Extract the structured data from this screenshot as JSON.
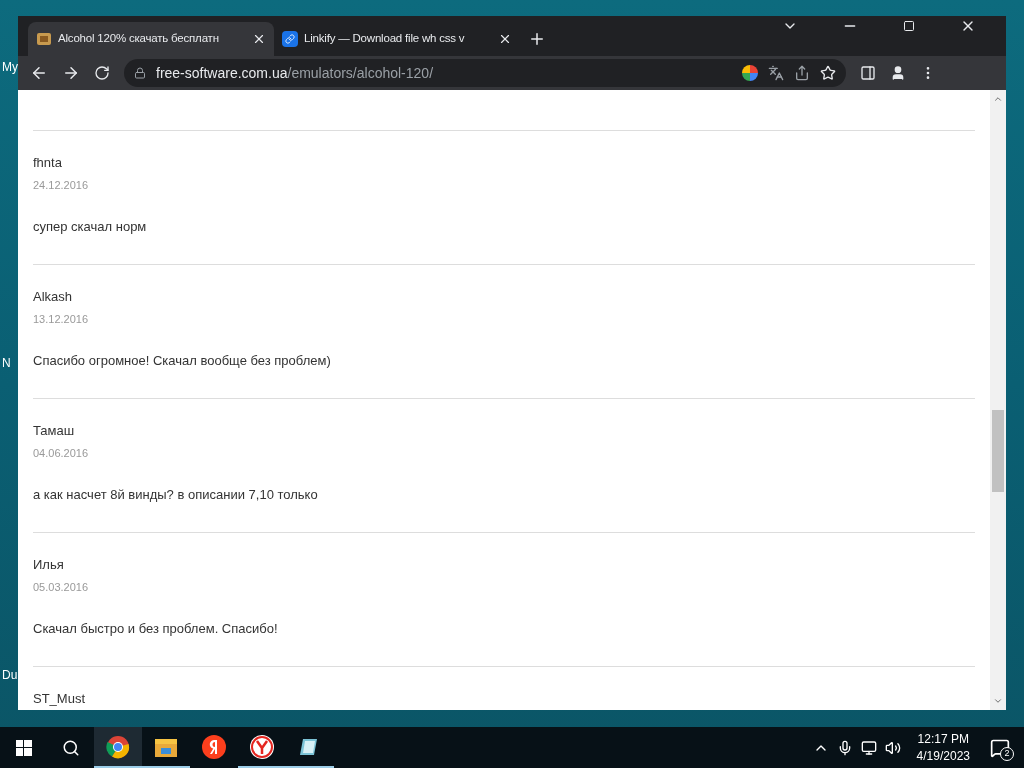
{
  "desktop": {
    "icon_labels": [
      "My",
      "N",
      "Du"
    ]
  },
  "browser": {
    "tabs": [
      {
        "title": "Alcohol 120% скачать бесплатн",
        "selected": true
      },
      {
        "title": "Linkify — Download file wh css v",
        "selected": false
      }
    ],
    "url": {
      "host": "free-software.com.ua",
      "path": "/emulators/alcohol-120/"
    }
  },
  "comments": [
    {
      "author": "fhnta",
      "date": "24.12.2016",
      "text": "супер скачал норм"
    },
    {
      "author": "Alkash",
      "date": "13.12.2016",
      "text": "Спасибо огромное! Скачал вообще без проблем)"
    },
    {
      "author": "Тамаш",
      "date": "04.06.2016",
      "text": "а как насчет 8й винды? в описании 7,10 только"
    },
    {
      "author": "Илья",
      "date": "05.03.2016",
      "text": "Скачал быстро и без проблем. Спасибо!"
    },
    {
      "author": "ST_Must"
    }
  ],
  "taskbar": {
    "apps": [
      {
        "kind": "chrome",
        "active": true
      },
      {
        "kind": "folder",
        "active": true
      },
      {
        "kind": "yandex",
        "active": false
      },
      {
        "kind": "ybrowser",
        "active": true
      },
      {
        "kind": "notepad",
        "active": true
      }
    ],
    "time": "12:17 PM",
    "date": "4/19/2023",
    "notifications": "2"
  }
}
